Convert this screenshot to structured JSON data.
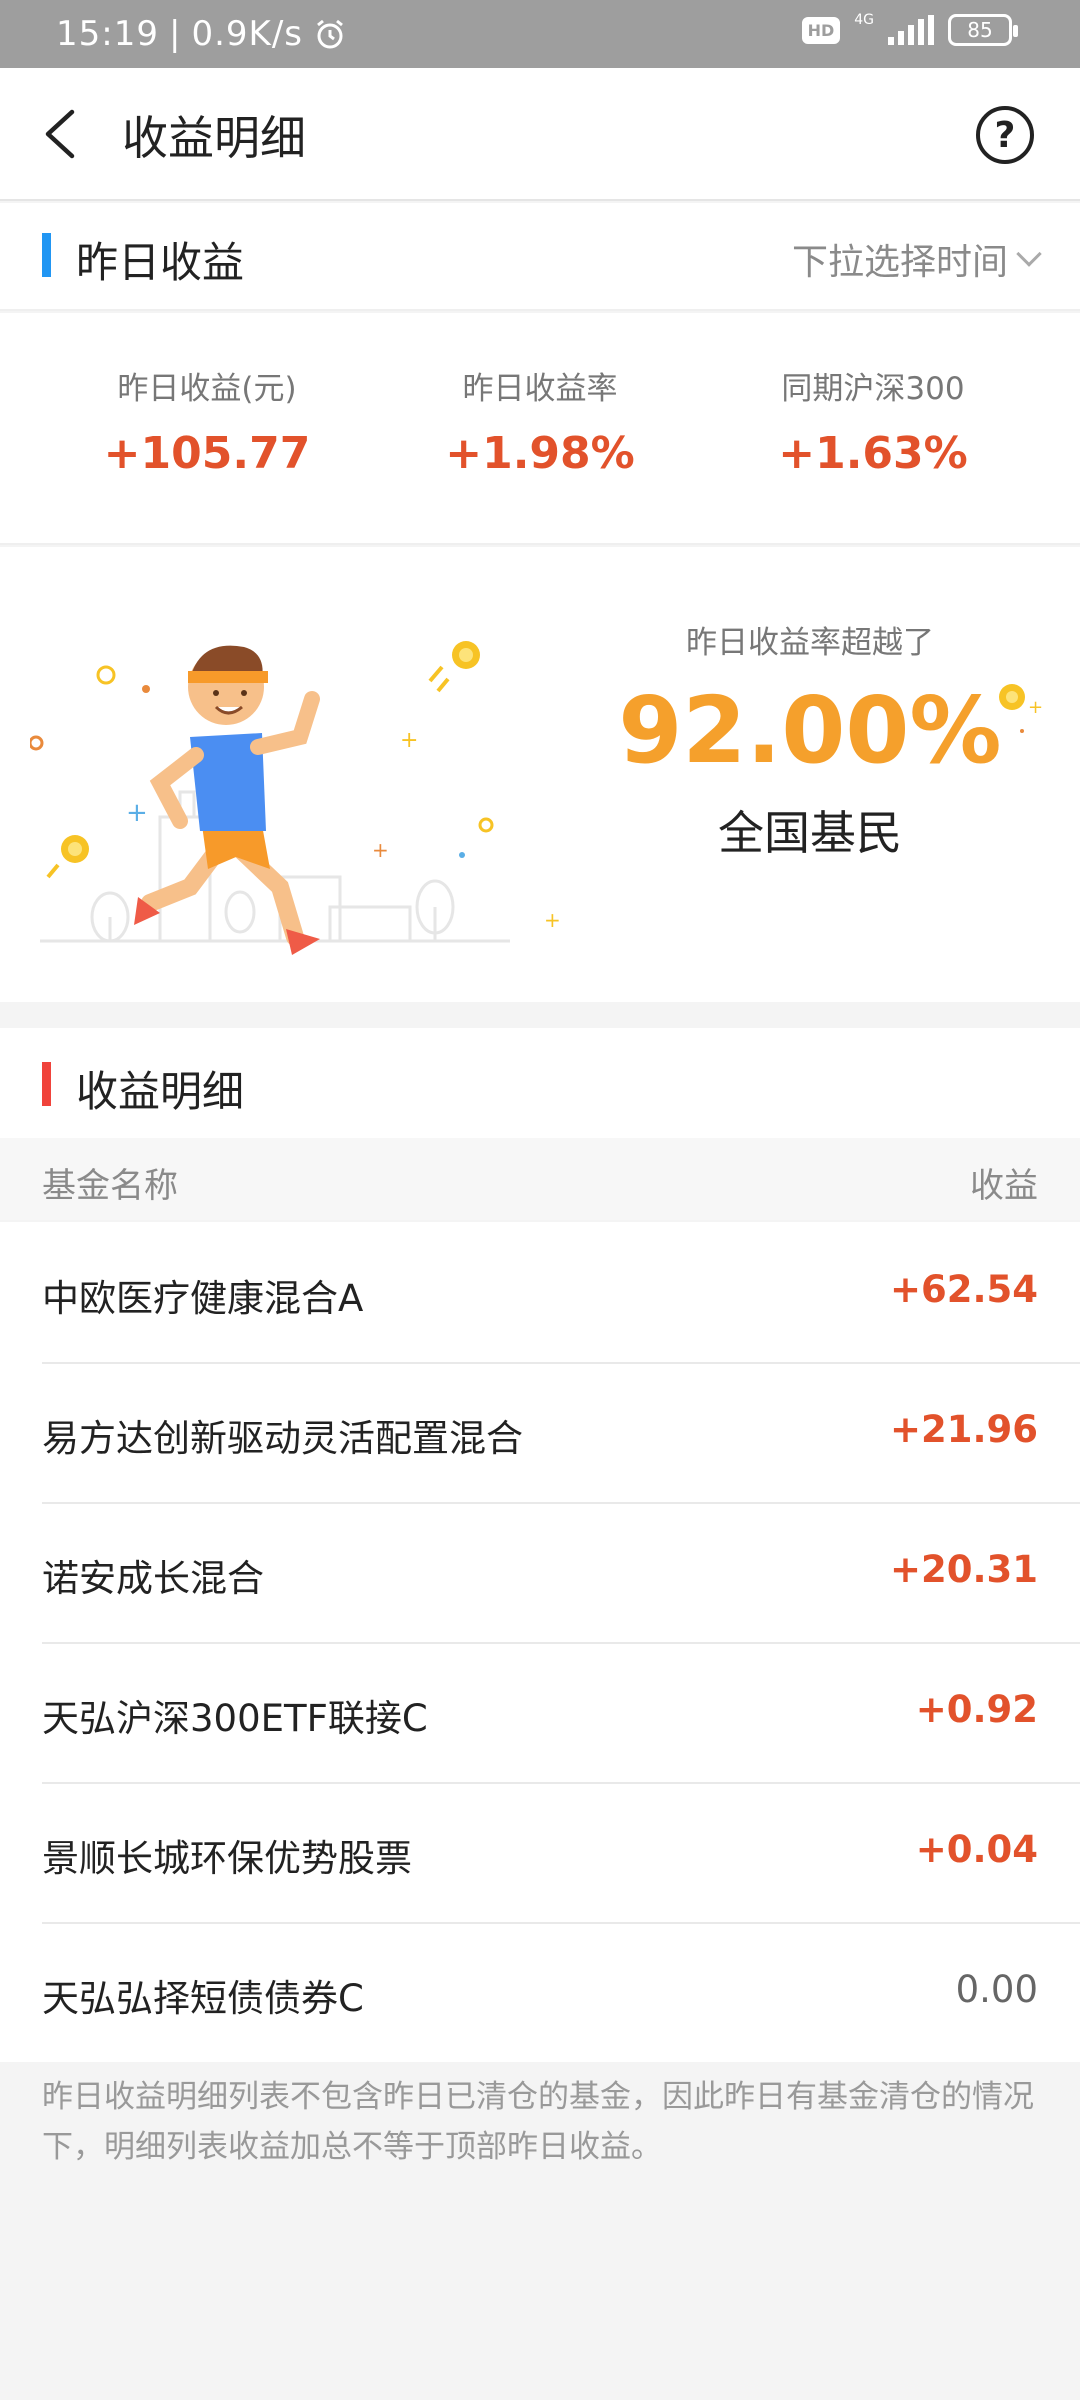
{
  "status_bar": {
    "time": "15:19",
    "net_speed": "0.9K/s",
    "hd": "HD",
    "network": "4G",
    "battery": "85"
  },
  "header": {
    "title": "收益明细",
    "help_symbol": "?"
  },
  "yesterday": {
    "section_title": "昨日收益",
    "time_select": "下拉选择时间",
    "stats": [
      {
        "label": "昨日收益(元)",
        "value": "+105.77"
      },
      {
        "label": "昨日收益率",
        "value": "+1.98%"
      },
      {
        "label": "同期沪深300",
        "value": "+1.63%"
      }
    ]
  },
  "banner": {
    "label": "昨日收益率超越了",
    "percent": "92.00%",
    "subtitle": "全国基民"
  },
  "detail": {
    "section_title": "收益明细",
    "col_name": "基金名称",
    "col_profit": "收益",
    "rows": [
      {
        "name": "中欧医疗健康混合A",
        "profit": "+62.54"
      },
      {
        "name": "易方达创新驱动灵活配置混合",
        "profit": "+21.96"
      },
      {
        "name": "诺安成长混合",
        "profit": "+20.31"
      },
      {
        "name": "天弘沪深300ETF联接C",
        "profit": "+0.92"
      },
      {
        "name": "景顺长城环保优势股票",
        "profit": "+0.04"
      },
      {
        "name": "天弘弘择短债债券C",
        "profit": "0.00"
      }
    ],
    "footnote": "昨日收益明细列表不包含昨日已清仓的基金，因此昨日有基金清仓的情况下，明细列表收益加总不等于顶部昨日收益。"
  },
  "colors": {
    "accent_blue": "#2196f3",
    "accent_red": "#f0433b",
    "positive": "#e2522b",
    "zero": "#666666",
    "highlight": "#f5a02c"
  }
}
